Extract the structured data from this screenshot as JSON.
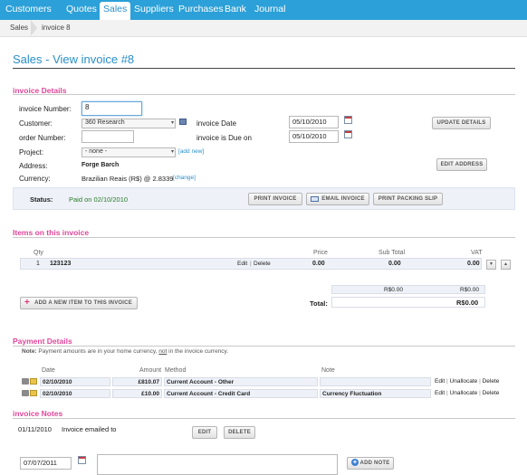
{
  "nav": {
    "items": [
      {
        "label": "Customers",
        "active": false
      },
      {
        "label": "Quotes",
        "active": false
      },
      {
        "label": "Sales",
        "active": true
      },
      {
        "label": "Suppliers",
        "active": false
      },
      {
        "label": "Purchases",
        "active": false
      },
      {
        "label": "Bank",
        "active": false
      },
      {
        "label": "Journal",
        "active": false
      }
    ]
  },
  "breadcrumb": [
    "Sales",
    "invoice 8"
  ],
  "page_title": "Sales - View invoice #8",
  "details": {
    "heading": "invoice Details",
    "invoice_number_label": "invoice Number:",
    "invoice_number_value": "8",
    "customer_label": "Customer:",
    "customer_value": "360 Research",
    "invoice_date_label": "invoice Date",
    "invoice_date_value": "05/10/2010",
    "update_button": "UPDATE DETAILS",
    "order_number_label": "order Number:",
    "order_number_value": "",
    "due_label": "invoice is Due on",
    "due_value": "05/10/2010",
    "project_label": "Project:",
    "project_value": "- none -",
    "add_new": "add new",
    "address_label": "Address:",
    "address_value": "Forge Barch",
    "edit_address_button": "EDIT ADDRESS",
    "currency_label": "Currency:",
    "currency_value": "Brazilian Reais (R$) @ 2.8339",
    "change_link": "change"
  },
  "status": {
    "label": "Status:",
    "value": "Paid on 02/10/2010",
    "print_button": "PRINT INVOICE",
    "email_button": "EMAIL INVOICE",
    "packing_button": "PRINT PACKING SLIP"
  },
  "items": {
    "heading": "Items on this invoice",
    "headers": {
      "qty": "Qty",
      "price": "Price",
      "subtotal": "Sub Total",
      "vat": "VAT"
    },
    "rows": [
      {
        "qty": "1",
        "name": "123123",
        "edit": "Edit",
        "sep": "|",
        "delete": "Delete",
        "price": "0.00",
        "subtotal": "0.00",
        "vat": "0.00"
      }
    ],
    "add_button": "ADD A NEW ITEM TO THIS INVOICE",
    "subtotal_value": "R$0.00",
    "vat_value": "R$0.00",
    "total_label": "Total:",
    "total_value": "R$0.00"
  },
  "payments": {
    "heading": "Payment Details",
    "note_prefix": "Note:",
    "note_text_1": "Payment amounts are in your home currency,",
    "note_not": "not",
    "note_text_2": "in the invoice currency.",
    "headers": {
      "date": "Date",
      "amount": "Amount",
      "method": "Method",
      "note": "Note"
    },
    "rows": [
      {
        "date": "02/10/2010",
        "amount": "£810.07",
        "method": "Current Account - Other",
        "note": "",
        "edit": "Edit",
        "unallocate": "Unallocate",
        "delete": "Delete"
      },
      {
        "date": "02/10/2010",
        "amount": "£10.00",
        "method": "Current Account - Credit Card",
        "note": "Currency Fluctuation",
        "edit": "Edit",
        "unallocate": "Unallocate",
        "delete": "Delete"
      }
    ]
  },
  "notes": {
    "heading": "invoice Notes",
    "entry_date": "01/11/2010",
    "entry_text": "Invoice emailed to",
    "edit_button": "EDIT",
    "delete_button": "DELETE",
    "new_date": "07/07/2011",
    "add_note_button": "ADD NOTE"
  },
  "colors": {
    "nav": "#2ca0d8",
    "accent": "#2a8fc8",
    "section": "#e0479a",
    "status_text": "#2a7a2a"
  }
}
